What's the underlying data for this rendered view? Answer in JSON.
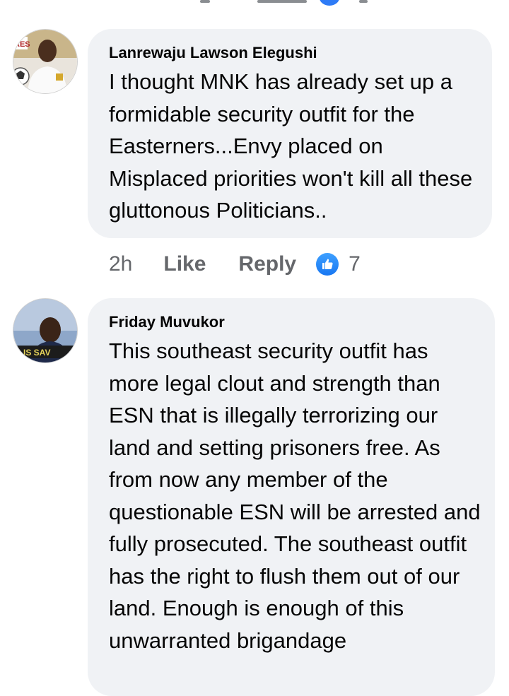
{
  "comments": [
    {
      "author": "Lanrewaju Lawson Elegushi",
      "avatar_badge": "AES",
      "text": "I thought MNK has already set up a formidable security outfit for the Easterners...Envy placed on Misplaced priorities won't kill all these gluttonous Politicians..",
      "time": "2h",
      "like_label": "Like",
      "reply_label": "Reply",
      "reaction_icon": "thumbs-up-icon",
      "reaction_count": "7"
    },
    {
      "author": "Friday Muvukor",
      "avatar_badge": "IS SAV",
      "text": "This southeast security outfit has more legal clout and strength than ESN that is illegally terrorizing our land and setting prisoners free. As from now any member of the questionable ESN will be arrested and fully prosecuted. The southeast outfit has the right to flush them out of our land. Enough is enough of this unwarranted brigandage"
    }
  ],
  "colors": {
    "bubble": "#f0f2f5",
    "text": "#050505",
    "meta": "#65676b",
    "like_blue": "#1877f2"
  }
}
